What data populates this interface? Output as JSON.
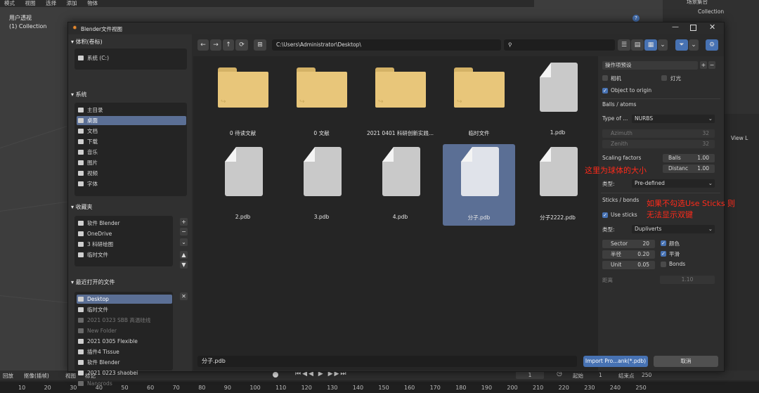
{
  "background": {
    "topbar": [
      "模式",
      "视图",
      "选择",
      "添加",
      "物体"
    ],
    "viewport_label": "用户透视",
    "viewport_collection": "(1) Collection",
    "right_panel": {
      "scene": "场景集合",
      "collection": "Collection",
      "view": "View L"
    },
    "timeline": {
      "labels": [
        "回放",
        "抠像(插帧)",
        "视图",
        "标记"
      ],
      "current_frame": "1",
      "start_label": "起始",
      "start": "1",
      "end_label": "结束点",
      "end": "250",
      "ticks": [
        "10",
        "20",
        "30",
        "40",
        "50",
        "60",
        "70",
        "80",
        "90",
        "100",
        "110",
        "120",
        "130",
        "140",
        "150",
        "160",
        "170",
        "180",
        "190",
        "200",
        "210",
        "220",
        "230",
        "240",
        "250"
      ]
    }
  },
  "dialog": {
    "title": "Blender文件视图",
    "sidebar": {
      "volumes_title": "体积(卷标)",
      "volumes": [
        {
          "label": "系统 (C:)"
        }
      ],
      "system_title": "系统",
      "system": [
        {
          "label": "主目录",
          "icon": "home-icon"
        },
        {
          "label": "桌面",
          "icon": "desktop-icon",
          "selected": true
        },
        {
          "label": "文档",
          "icon": "document-icon"
        },
        {
          "label": "下载",
          "icon": "download-icon"
        },
        {
          "label": "音乐",
          "icon": "music-icon"
        },
        {
          "label": "图片",
          "icon": "image-icon"
        },
        {
          "label": "视频",
          "icon": "video-icon"
        },
        {
          "label": "字体",
          "icon": "font-icon"
        }
      ],
      "bookmarks_title": "收藏夹",
      "bookmarks": [
        {
          "label": "软件 Blender"
        },
        {
          "label": "OneDrive"
        },
        {
          "label": "3 科研绘图"
        },
        {
          "label": "临时文件"
        }
      ],
      "recent_title": "最近打开的文件",
      "recent": [
        {
          "label": "Desktop",
          "selected": true
        },
        {
          "label": "临时文件"
        },
        {
          "label": "2021 0323 SBB 高温硅线",
          "dim": true
        },
        {
          "label": "New Folder",
          "dim": true
        },
        {
          "label": "2021 0305 Flexible"
        },
        {
          "label": "插件4 Tissue"
        },
        {
          "label": "软件 Blender"
        },
        {
          "label": "2021 0223 shaobei"
        },
        {
          "label": "Nanorods",
          "dim": true
        }
      ]
    },
    "path": "C:\\Users\\Administrator\\Desktop\\",
    "search_placeholder": "",
    "files": [
      {
        "name": "0 待读文献",
        "type": "folder"
      },
      {
        "name": "0 文献",
        "type": "folder"
      },
      {
        "name": "2021 0401 科研创新实践...",
        "type": "folder"
      },
      {
        "name": "临时文件",
        "type": "folder"
      },
      {
        "name": "1.pdb",
        "type": "file"
      },
      {
        "name": "2.pdb",
        "type": "file"
      },
      {
        "name": "3.pdb",
        "type": "file"
      },
      {
        "name": "4.pdb",
        "type": "file"
      },
      {
        "name": "分子.pdb",
        "type": "file",
        "selected": true
      },
      {
        "name": "分子2222.pdb",
        "type": "file"
      }
    ],
    "options": {
      "preset": "操作项预设",
      "camera": "相机",
      "light": "灯光",
      "object_to_origin": "Object to origin",
      "balls_section": "Balls / atoms",
      "type_of_label": "Type of ...",
      "type_of_value": "NURBS",
      "azimuth_label": "Azimuth",
      "azimuth": "32",
      "zenith_label": "Zenith",
      "zenith": "32",
      "scaling_label": "Scaling factors",
      "balls_label": "Balls",
      "balls": "1.00",
      "distance_label": "Distanc",
      "distance": "1.00",
      "type_label": "类型:",
      "scaling_type": "Pre-defined",
      "sticks_section": "Sticks / bonds",
      "use_sticks": "Use sticks",
      "sticks_type": "Dupliverts",
      "sector_label": "Sector",
      "sector": "20",
      "radius_label": "半径",
      "radius": "0.20",
      "unit_label": "Unit",
      "unit": "0.05",
      "color": "颜色",
      "smooth": "平滑",
      "bonds": "Bonds",
      "dist_label": "距离",
      "dist": "1.10"
    },
    "filename": "分子.pdb",
    "import_button": "Import Pro...ank(*.pdb)",
    "cancel_button": "取消"
  },
  "annotations": {
    "ball_note": "这里为球体的大小",
    "sticks_note_1": "如果不勾选Use Sticks 则",
    "sticks_note_2": "无法显示双键"
  },
  "colors": {
    "accent": "#4772b3",
    "selection": "#5b6f95",
    "folder": "#e8c67a",
    "note": "#ff2a1a"
  }
}
